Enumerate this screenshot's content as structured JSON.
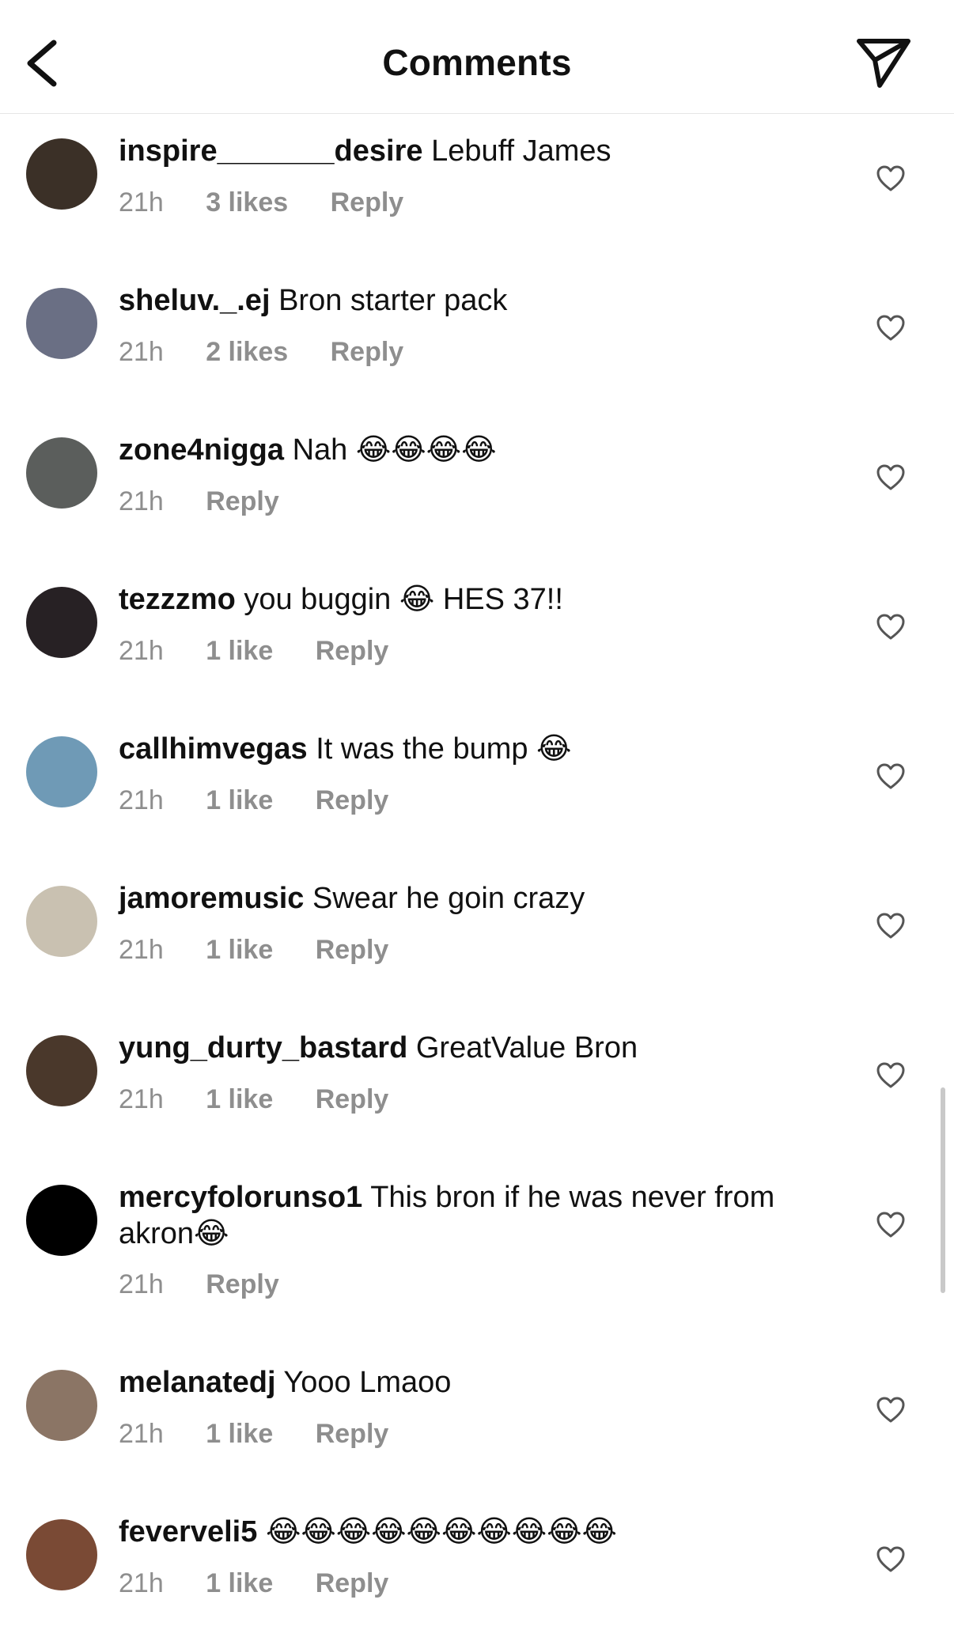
{
  "header": {
    "title": "Comments",
    "back_icon": "chevron-left-icon",
    "share_icon": "paper-plane-icon"
  },
  "comments": [
    {
      "username": "inspire_______desire",
      "text": "Lebuff James",
      "time": "21h",
      "likes": "3 likes",
      "reply": "Reply",
      "avatar_color": "#3b3027"
    },
    {
      "username": "sheluv._.ej",
      "text": "Bron starter pack",
      "time": "21h",
      "likes": "2 likes",
      "reply": "Reply",
      "avatar_color": "#6a6f84"
    },
    {
      "username": "zone4nigga",
      "text": "Nah 😂😂😂😂",
      "time": "21h",
      "likes": "",
      "reply": "Reply",
      "avatar_color": "#5b5e5c"
    },
    {
      "username": "tezzzmo",
      "text": "you buggin 😂 HES 37!!",
      "time": "21h",
      "likes": "1 like",
      "reply": "Reply",
      "avatar_color": "#272124"
    },
    {
      "username": "callhimvegas",
      "text": "It was the bump 😂",
      "time": "21h",
      "likes": "1 like",
      "reply": "Reply",
      "avatar_color": "#6f9ab6"
    },
    {
      "username": "jamoremusic",
      "text": "Swear he goin crazy",
      "time": "21h",
      "likes": "1 like",
      "reply": "Reply",
      "avatar_color": "#c9c1b1"
    },
    {
      "username": "yung_durty_bastard",
      "text": "GreatValue Bron",
      "time": "21h",
      "likes": "1 like",
      "reply": "Reply",
      "avatar_color": "#4a382b"
    },
    {
      "username": "mercyfolorunso1",
      "text": "This bron if he was never from akron😂",
      "time": "21h",
      "likes": "",
      "reply": "Reply",
      "avatar_color": "#000000"
    },
    {
      "username": "melanatedj",
      "text": "Yooo Lmaoo",
      "time": "21h",
      "likes": "1 like",
      "reply": "Reply",
      "avatar_color": "#8b7565"
    },
    {
      "username": "feverveli5",
      "text": "😂😂😂😂😂😂😂😂😂😂",
      "time": "21h",
      "likes": "1 like",
      "reply": "Reply",
      "avatar_color": "#7a4a35"
    }
  ],
  "heart_icon": "heart-outline-icon"
}
